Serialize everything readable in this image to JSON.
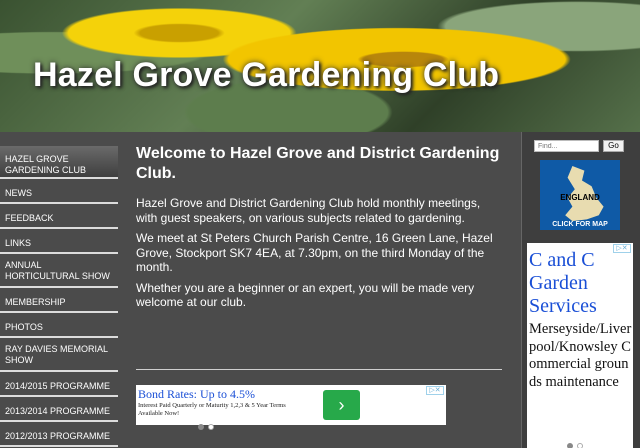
{
  "header": {
    "title": "Hazel Grove Gardening Club"
  },
  "nav": {
    "items": [
      {
        "label": "HAZEL GROVE GARDENING CLUB",
        "active": true
      },
      {
        "label": "NEWS"
      },
      {
        "label": "FEEDBACK"
      },
      {
        "label": "LINKS"
      },
      {
        "label": "ANNUAL HORTICULTURAL SHOW"
      },
      {
        "label": "MEMBERSHIP"
      },
      {
        "label": "PHOTOS"
      },
      {
        "label": "RAY DAVIES MEMORIAL SHOW"
      },
      {
        "label": "2014/2015 PROGRAMME"
      },
      {
        "label": "2013/2014 PROGRAMME"
      },
      {
        "label": "2012/2013 PROGRAMME"
      }
    ]
  },
  "main": {
    "heading": "Welcome to Hazel Grove and District Gardening Club.",
    "paragraphs": [
      "Hazel Grove and District Gardening Club hold monthly meetings, with guest speakers, on various subjects related to gardening.",
      "We meet at St Peters Church Parish Centre, 16 Green Lane, Hazel Grove, Stockport SK7 4EA, at 7.30pm, on the third Monday of the month.",
      "Whether you are a beginner or an expert, you will be made very welcome at our club."
    ]
  },
  "ad_bottom": {
    "headline": "Bond Rates: Up to 4.5%",
    "body": "Interest Paid Quarterly or Maturity 1,2,3 & 5 Year Terms Available Now!",
    "go_glyph": "›",
    "adchoice": "▷✕"
  },
  "sidebar_right": {
    "search_placeholder": "Find...",
    "search_button": "Go",
    "map_label": "ENGLAND",
    "map_cta": "CLICK FOR MAP"
  },
  "ad_right": {
    "headline": "C and C Garden Services",
    "body": "Merseyside/Liverpool/Knowsley Commercial grounds maintenance",
    "adchoice": "▷✕"
  },
  "colors": {
    "background": "#4b4b4b",
    "ad_link": "#1a4fd6",
    "ad_button": "#27a94a"
  }
}
